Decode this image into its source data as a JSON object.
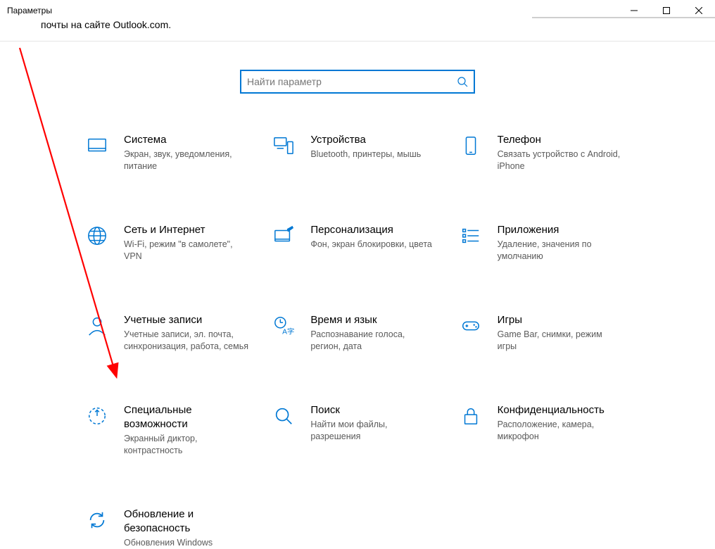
{
  "window": {
    "title": "Параметры",
    "subline": "почты на сайте Outlook.com."
  },
  "search": {
    "placeholder": "Найти параметр"
  },
  "tiles": [
    {
      "id": "system",
      "title": "Система",
      "desc": "Экран, звук, уведомления, питание"
    },
    {
      "id": "devices",
      "title": "Устройства",
      "desc": "Bluetooth, принтеры, мышь"
    },
    {
      "id": "phone",
      "title": "Телефон",
      "desc": "Связать устройство с Android, iPhone"
    },
    {
      "id": "network",
      "title": "Сеть и Интернет",
      "desc": "Wi-Fi, режим \"в самолете\", VPN"
    },
    {
      "id": "personal",
      "title": "Персонализация",
      "desc": "Фон, экран блокировки, цвета"
    },
    {
      "id": "apps",
      "title": "Приложения",
      "desc": "Удаление, значения по умолчанию"
    },
    {
      "id": "accounts",
      "title": "Учетные записи",
      "desc": "Учетные записи, эл. почта, синхронизация, работа, семья"
    },
    {
      "id": "time",
      "title": "Время и язык",
      "desc": "Распознавание голоса, регион, дата"
    },
    {
      "id": "gaming",
      "title": "Игры",
      "desc": "Game Bar, снимки, режим игры"
    },
    {
      "id": "ease",
      "title": "Специальные возможности",
      "desc": "Экранный диктор, контрастность"
    },
    {
      "id": "search",
      "title": "Поиск",
      "desc": "Найти мои файлы, разрешения"
    },
    {
      "id": "privacy",
      "title": "Конфиденциальность",
      "desc": "Расположение, камера, микрофон"
    },
    {
      "id": "update",
      "title": "Обновление и безопасность",
      "desc": "Обновления Windows"
    }
  ]
}
